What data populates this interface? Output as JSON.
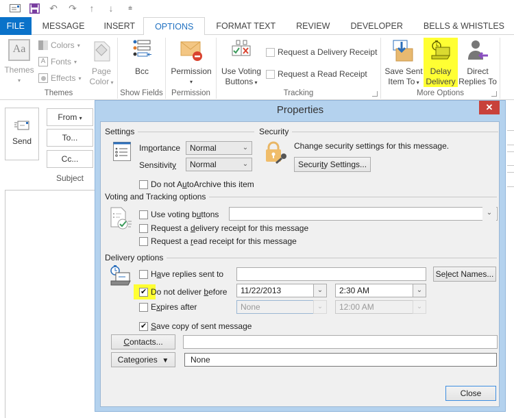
{
  "quick_access": {
    "icons": [
      "message-icon",
      "save-icon",
      "undo-icon",
      "redo-icon",
      "previous-item-icon",
      "next-item-icon",
      "customize-toolbar-icon"
    ]
  },
  "tabs": [
    {
      "label": "FILE"
    },
    {
      "label": "MESSAGE"
    },
    {
      "label": "INSERT"
    },
    {
      "label": "OPTIONS",
      "active": true
    },
    {
      "label": "FORMAT TEXT"
    },
    {
      "label": "REVIEW"
    },
    {
      "label": "DEVELOPER"
    },
    {
      "label": "BELLS & WHISTLES"
    }
  ],
  "ribbon": {
    "themes": {
      "group_label": "Themes",
      "themes_button": "Themes",
      "colors": "Colors",
      "fonts": "Fonts",
      "effects": "Effects",
      "page_color_line1": "Page",
      "page_color_line2": "Color"
    },
    "show_fields": {
      "group_label": "Show Fields",
      "bcc": "Bcc"
    },
    "permission": {
      "group_label": "Permission",
      "permission": "Permission"
    },
    "tracking": {
      "group_label": "Tracking",
      "use_voting_line1": "Use Voting",
      "use_voting_line2": "Buttons",
      "request_delivery": "Request a Delivery Receipt",
      "request_read": "Request a Read Receipt"
    },
    "more_options": {
      "group_label": "More Options",
      "save_sent_line1": "Save Sent",
      "save_sent_line2": "Item To",
      "delay_line1": "Delay",
      "delay_line2": "Delivery",
      "direct_line1": "Direct",
      "direct_line2": "Replies To"
    }
  },
  "compose": {
    "send": "Send",
    "from": "From",
    "to": "To...",
    "cc": "Cc...",
    "subject": "Subject"
  },
  "dialog": {
    "title": "Properties",
    "close_x": "✕",
    "settings": {
      "heading": "Settings",
      "importance_label": "Importance",
      "importance_value": "Normal",
      "sensitivity_label": "Sensitivity",
      "sensitivity_value": "Normal",
      "autoarchive_label": "Do not AutoArchive this item",
      "autoarchive_checked": false
    },
    "security": {
      "heading": "Security",
      "description": "Change security settings for this message.",
      "button": "Security Settings..."
    },
    "voting": {
      "heading": "Voting and Tracking options",
      "use_voting_label": "Use voting buttons",
      "use_voting_checked": false,
      "use_voting_value": "",
      "delivery_receipt_label": "Request a delivery receipt for this message",
      "delivery_receipt_checked": false,
      "read_receipt_label": "Request a read receipt for this message",
      "read_receipt_checked": false
    },
    "delivery": {
      "heading": "Delivery options",
      "replies_label": "Have replies sent to",
      "replies_checked": false,
      "replies_value": "",
      "select_names": "Select Names...",
      "dnd_label": "Do not deliver before",
      "dnd_checked": true,
      "dnd_date": "11/22/2013",
      "dnd_time": "2:30 AM",
      "expires_label": "Expires after",
      "expires_checked": false,
      "expires_date": "None",
      "expires_time": "12:00 AM",
      "save_copy_label": "Save copy of sent message",
      "save_copy_checked": true
    },
    "contacts_button": "Contacts...",
    "contacts_value": "",
    "categories_button": "Categories",
    "categories_value": "None",
    "close_button": "Close"
  },
  "colors": {
    "file_tab": "#0a72c9",
    "active_tab_text": "#1f70c1",
    "highlight": "#ffff33",
    "dialog_frame": "#b4d2ee",
    "close_red": "#c8413b"
  }
}
